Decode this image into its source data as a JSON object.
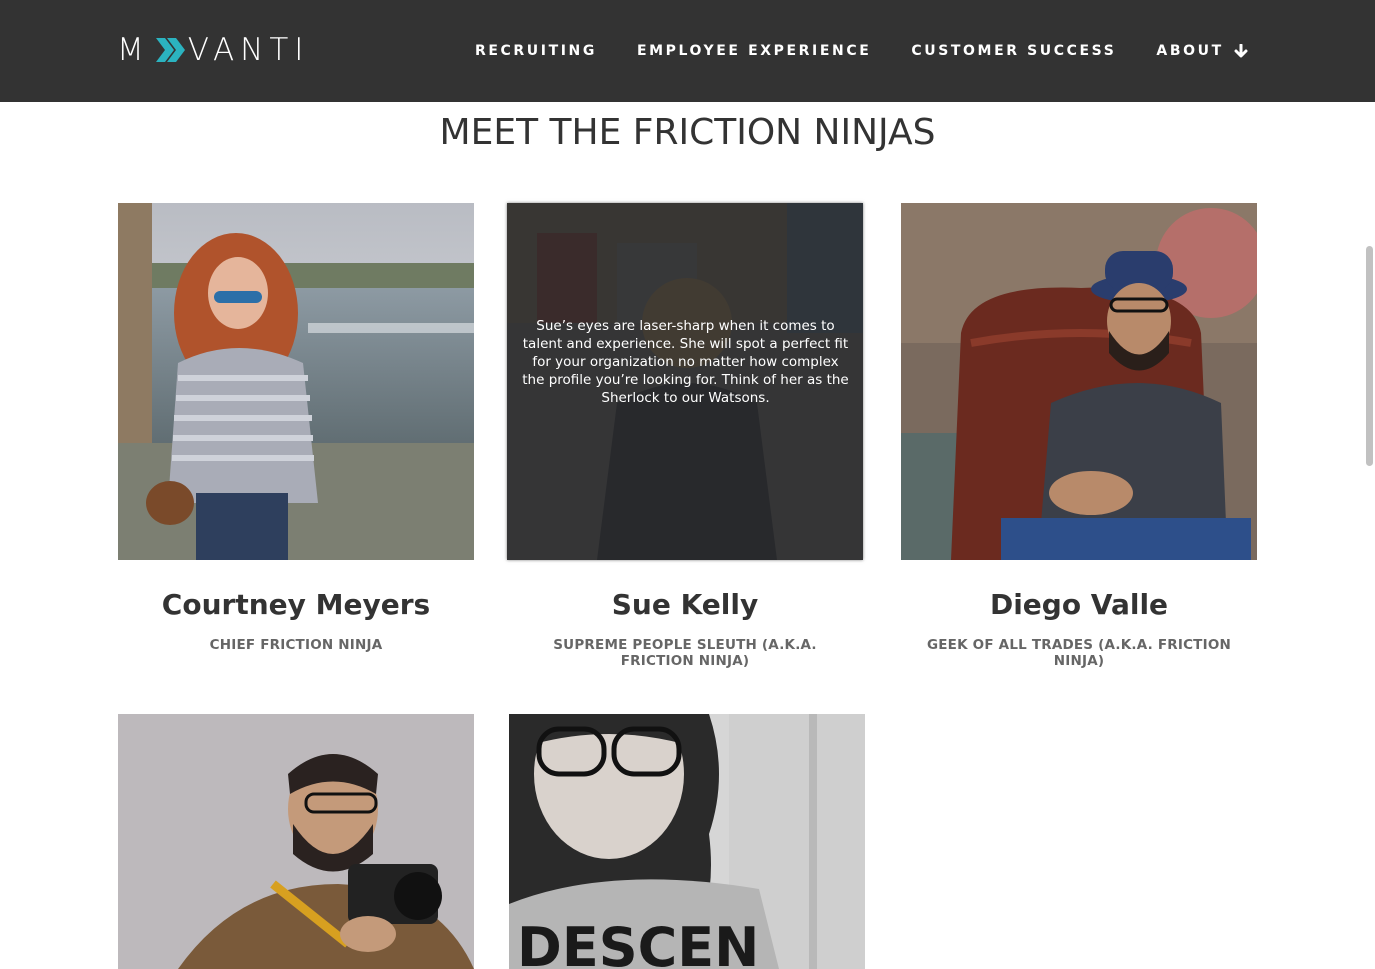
{
  "header": {
    "logo_text_m": "M",
    "logo_text_rest": "VANTI",
    "logo_accent": "#2bb3c0",
    "nav": [
      {
        "label": "RECRUITING"
      },
      {
        "label": "EMPLOYEE EXPERIENCE"
      },
      {
        "label": "CUSTOMER SUCCESS"
      },
      {
        "label": "ABOUT",
        "icon": "arrow-down-icon"
      }
    ]
  },
  "main": {
    "title": "MEET THE FRICTION NINJAS",
    "team": [
      {
        "name": "Courtney Meyers",
        "role": "CHIEF FRICTION NINJA"
      },
      {
        "name": "Sue Kelly",
        "role": "SUPREME PEOPLE SLEUTH (A.K.A. FRICTION NINJA)",
        "bio": "Sue’s eyes are laser-sharp when it comes to talent and experience. She will spot a perfect fit for your organization no matter how complex the profile you’re looking for. Think of her as the Sherlock to our Watsons."
      },
      {
        "name": "Diego Valle",
        "role": "GEEK OF ALL TRADES (A.K.A. FRICTION NINJA)"
      },
      {
        "name": "",
        "role": ""
      },
      {
        "name": "",
        "role": ""
      }
    ]
  },
  "colors": {
    "topbar": "#333333",
    "text": "#333333",
    "role_text": "#666666"
  }
}
